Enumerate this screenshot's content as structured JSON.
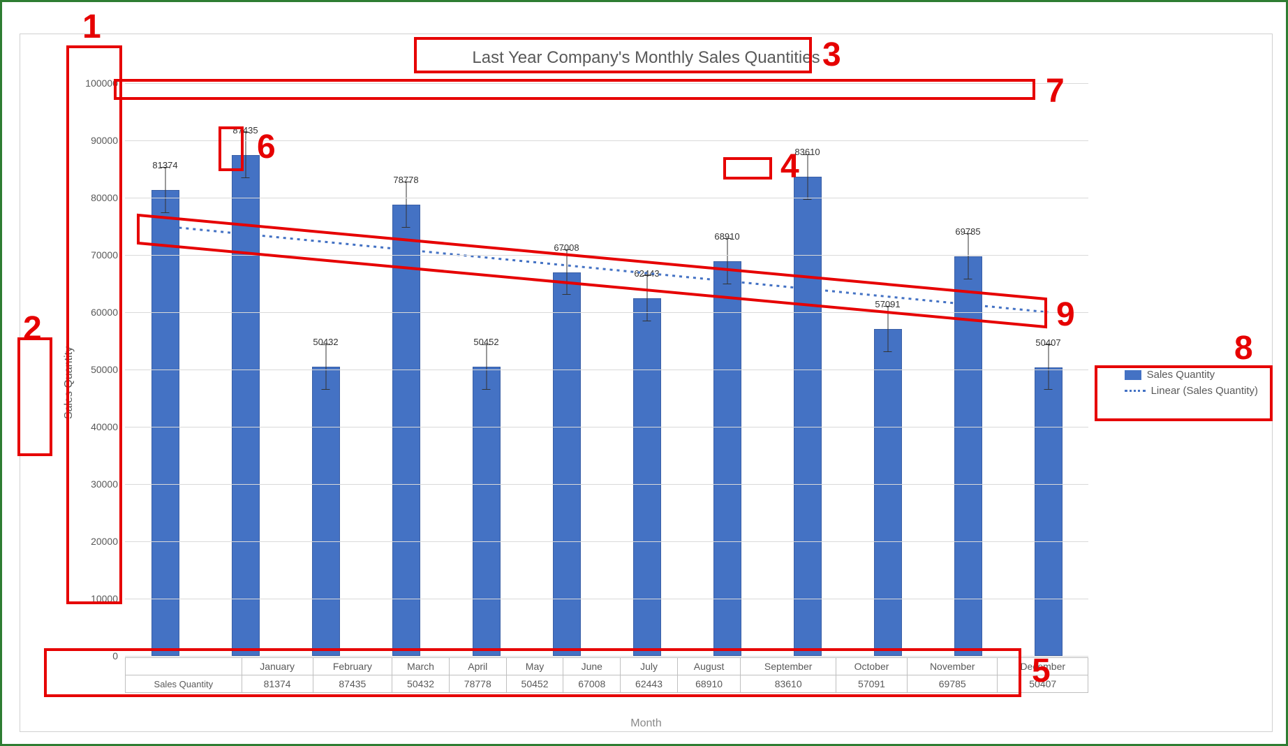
{
  "chart_data": {
    "type": "bar",
    "title": "Last Year Company's Monthly Sales Quantities",
    "xlabel": "Month",
    "ylabel": "Sales Quantity",
    "ylim": [
      0,
      100000
    ],
    "ytick_step": 10000,
    "categories": [
      "January",
      "February",
      "March",
      "April",
      "May",
      "June",
      "July",
      "August",
      "September",
      "October",
      "November",
      "December"
    ],
    "series": [
      {
        "name": "Sales Quantity",
        "values": [
          81374,
          87435,
          50432,
          78778,
          50452,
          67008,
          62443,
          68910,
          83610,
          57091,
          69785,
          50407
        ]
      }
    ],
    "error_amount": 4000,
    "trendline": {
      "name": "Linear (Sales Quantity)",
      "start_y": 75000,
      "end_y": 60000
    },
    "data_table_row_label": "Sales Quantity"
  },
  "legend": {
    "series_label": "Sales Quantity",
    "trend_label": "Linear (Sales Quantity)"
  },
  "annotations": {
    "n1": "1",
    "n2": "2",
    "n3": "3",
    "n4": "4",
    "n5": "5",
    "n6": "6",
    "n7": "7",
    "n8": "8",
    "n9": "9"
  }
}
